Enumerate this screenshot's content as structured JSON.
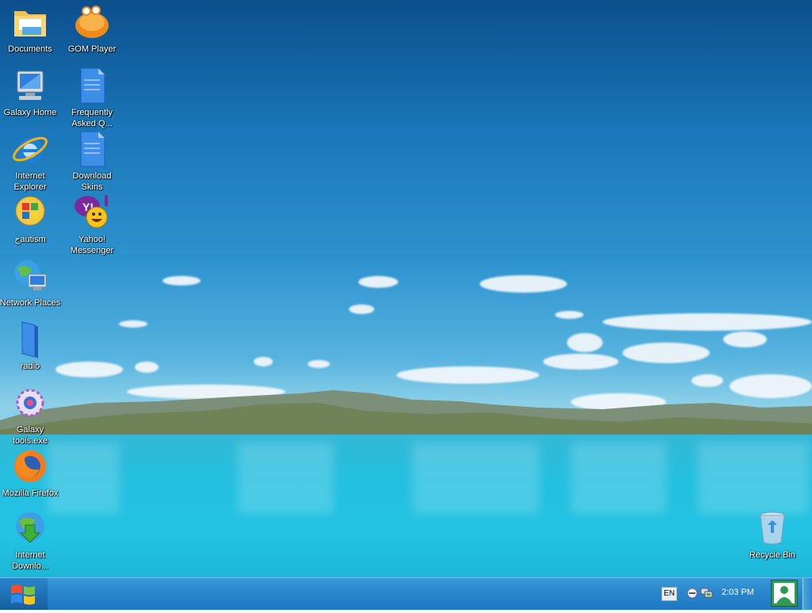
{
  "desktop": {
    "icons": [
      {
        "label": "Documents",
        "icon": "folder-icon"
      },
      {
        "label": "GOM Player",
        "icon": "gom-player-icon"
      },
      {
        "label": "Galaxy Home",
        "icon": "computer-icon"
      },
      {
        "label": "Frequently Asked Q...",
        "icon": "document-icon"
      },
      {
        "label": "Internet Explorer",
        "icon": "internet-explorer-icon"
      },
      {
        "label": "Download Skins",
        "icon": "document-icon"
      },
      {
        "label": "جautism",
        "icon": "control-panel-icon"
      },
      {
        "label": "Yahoo! Messenger",
        "icon": "yahoo-messenger-icon"
      },
      {
        "label": "Network Places",
        "icon": "network-places-icon"
      },
      {
        "label": "radio",
        "icon": "folder-icon"
      },
      {
        "label": "Galaxy tools.exe",
        "icon": "galaxy-tools-icon"
      },
      {
        "label": "Mozilla Firefox",
        "icon": "firefox-icon"
      },
      {
        "label": "Internet Downlo...",
        "icon": "internet-download-manager-icon"
      },
      {
        "label": "Recycle Bin",
        "icon": "recycle-bin-icon"
      }
    ]
  },
  "taskbar": {
    "start_icon": "windows-logo-icon",
    "language": "EN",
    "clock": "2:03 PM",
    "user_icon": "user-icon"
  },
  "colors": {
    "taskbar": "#2a86cc",
    "sky_top": "#0b4f8c",
    "lake": "#22c3e3"
  }
}
